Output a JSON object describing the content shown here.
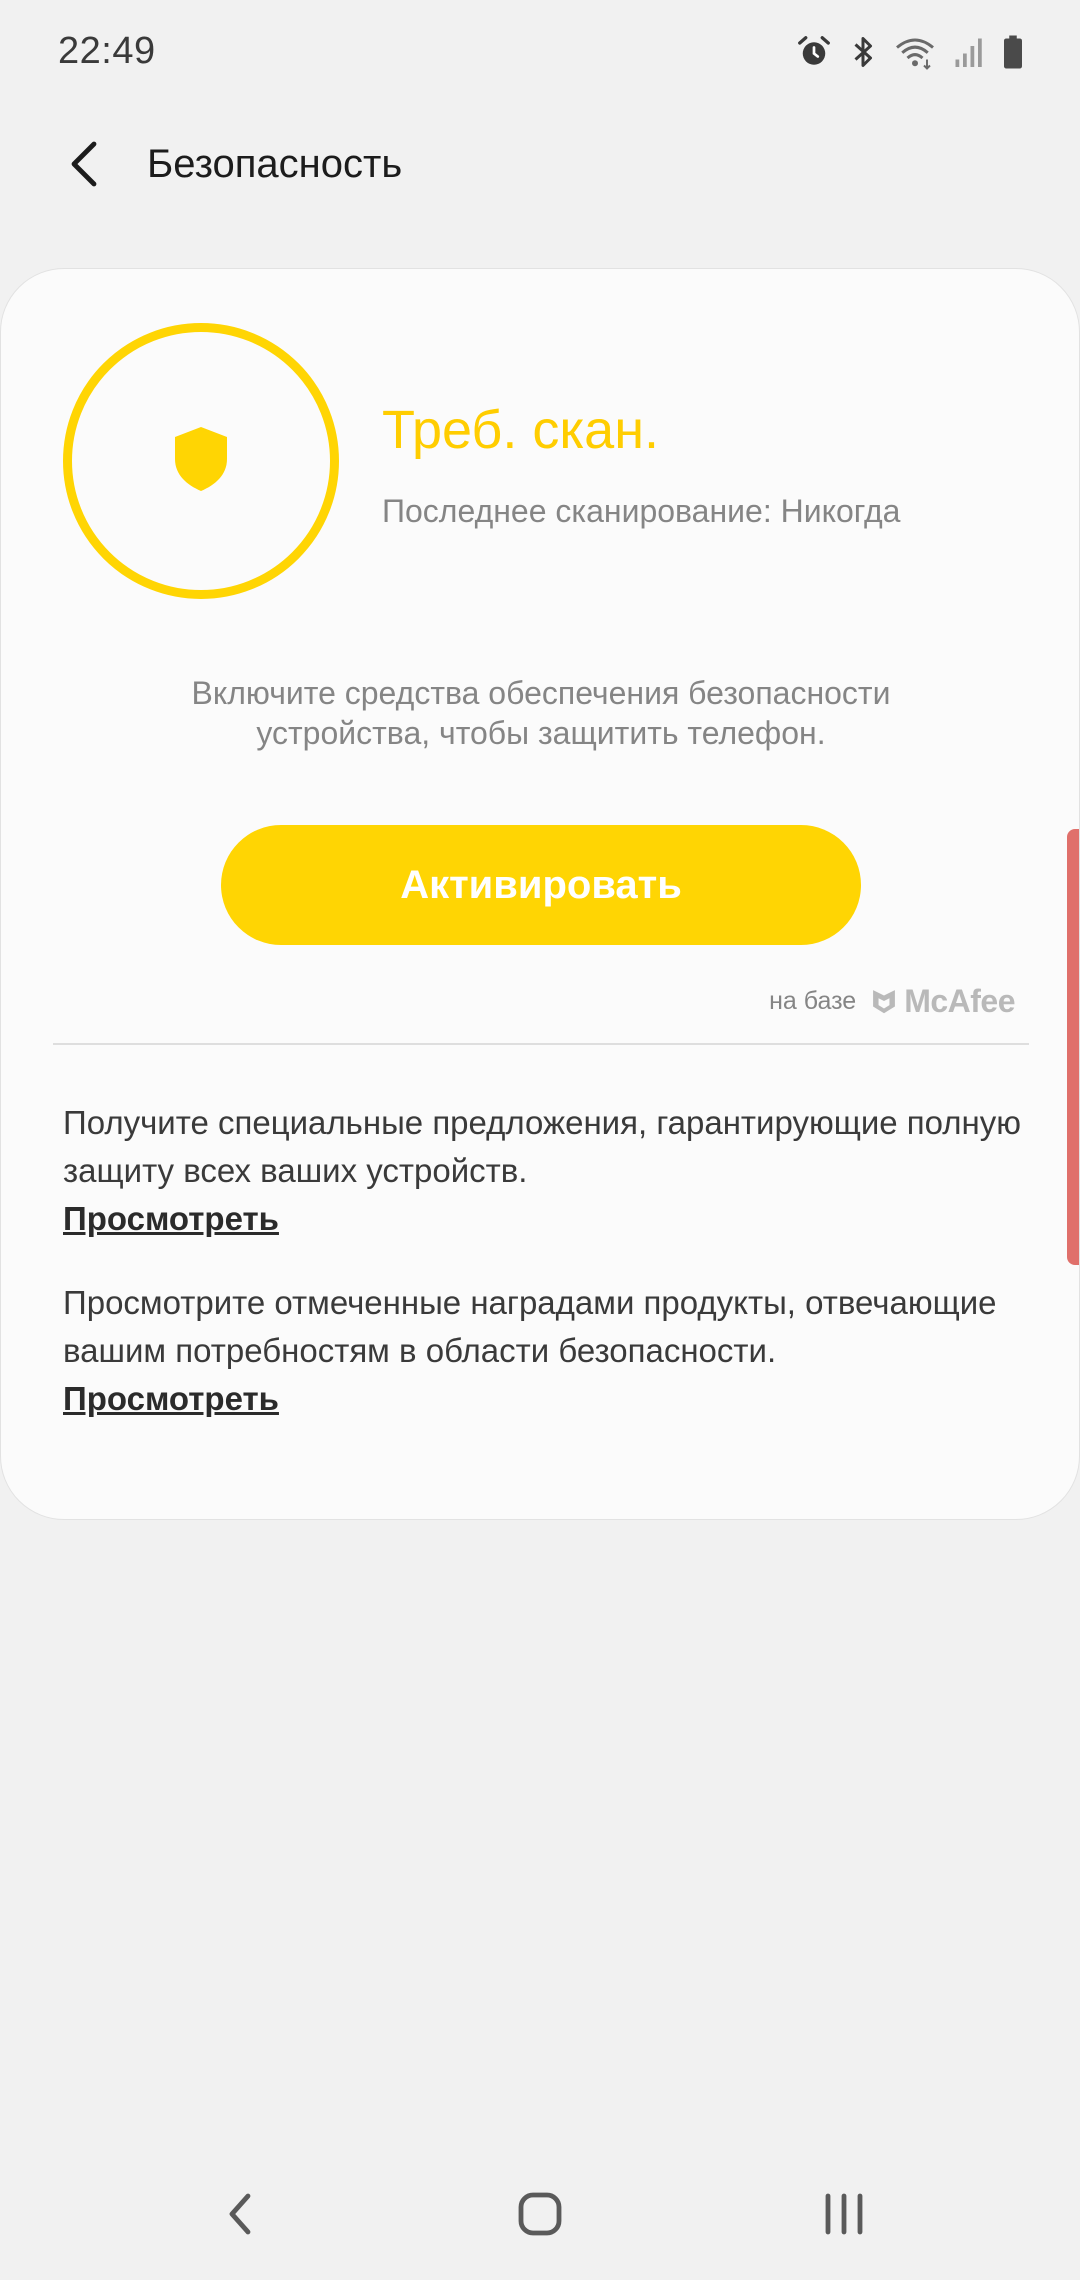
{
  "status_bar": {
    "time": "22:49",
    "icons": [
      "alarm-icon",
      "bluetooth-icon",
      "wifi-icon",
      "signal-icon",
      "battery-icon"
    ]
  },
  "header": {
    "title": "Безопасность",
    "back_icon": "back-arrow-icon"
  },
  "scan": {
    "status": "Треб. скан.",
    "last_scan": "Последнее сканирование: Никогда",
    "description": "Включите средства обеспечения безопасности устройства, чтобы защитить телефон.",
    "activate_label": "Активировать",
    "powered_by": "на базе",
    "brand": "McAfee",
    "accent_color": "#ffd503"
  },
  "offers": [
    {
      "text": "Получите специальные предложения, гарантирующие полную защиту всех ваших устройств.",
      "link": "Просмотреть"
    },
    {
      "text": "Просмотрите отмеченные наградами продукты, отвечающие вашим потребностям в области безопасности.",
      "link": "Просмотреть"
    }
  ],
  "nav": {
    "icons": [
      "nav-back-icon",
      "nav-home-icon",
      "nav-recents-icon"
    ]
  }
}
